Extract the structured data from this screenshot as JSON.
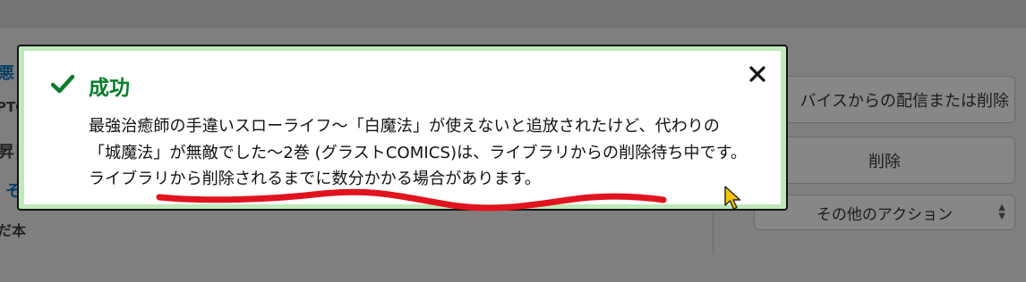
{
  "background": {
    "fragments": [
      "悪",
      "PTO",
      "昇日",
      "そ",
      "だ本"
    ],
    "buttons": {
      "deliver_or_delete": "バイスからの配信または削除",
      "delete": "削除",
      "more_actions": "その他のアクション"
    }
  },
  "dialog": {
    "title": "成功",
    "message": "最強治癒師の手違いスローライフ〜「白魔法」が使えないと追放されたけど、代わりの「城魔法」が無敵でした〜2巻 (グラストCOMICS)は、ライブラリからの削除待ち中です。ライブラリから削除されるまでに数分かかる場合があります。",
    "close_icon": "close-icon",
    "status_icon": "checkmark-icon"
  },
  "colors": {
    "success_green": "#067d2a",
    "dialog_border_tint": "#bfe9b9",
    "annotation_red": "#e0141e"
  }
}
